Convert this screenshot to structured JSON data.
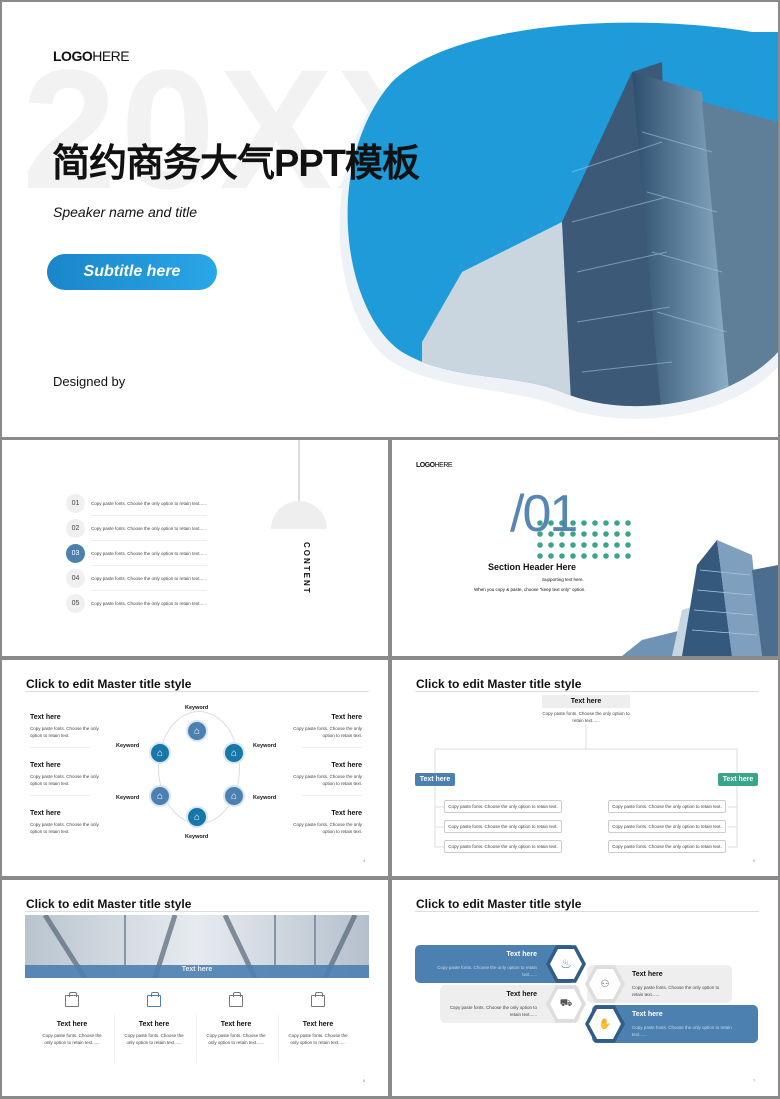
{
  "cover": {
    "bg_text": "20XX",
    "logo_bold": "LOGO",
    "logo_light": "HERE",
    "title": "简约商务大气PPT模板",
    "speaker": "Speaker name and title",
    "subtitle_button": "Subtitle here",
    "designed_by": "Designed by",
    "accent": "#1e9bd8"
  },
  "contents": {
    "vertical_label": "CONTENT",
    "items": [
      {
        "num": "01",
        "text": "Copy paste fonts. Choose the only option to retain text......"
      },
      {
        "num": "02",
        "text": "Copy paste fonts. Choose the only option to retain text......"
      },
      {
        "num": "03",
        "text": "Copy paste fonts. Choose the only option to retain text......",
        "active": true
      },
      {
        "num": "04",
        "text": "Copy paste fonts. Choose the only option to retain text......"
      },
      {
        "num": "05",
        "text": "Copy paste fonts. Choose the only option to retain text......"
      }
    ]
  },
  "section": {
    "logo_bold": "LOGO",
    "logo_light": "HERE",
    "number": "/01",
    "header": "Section Header Here",
    "supporting": "Supporting text here.",
    "note": "When you copy & paste, choose \"keep text only\" option.",
    "dot_color": "#3aa58a"
  },
  "slide4": {
    "title": "Click to edit Master title style",
    "left": [
      {
        "heading": "Text here",
        "body": "Copy paste fonts. Choose the only option to retain text."
      },
      {
        "heading": "Text here",
        "body": "Copy paste fonts. Choose the only option to retain text."
      },
      {
        "heading": "Text here",
        "body": "Copy paste fonts. Choose the only option to retain text."
      }
    ],
    "right": [
      {
        "heading": "Text here",
        "body": "Copy paste fonts. Choose the only option to retain text."
      },
      {
        "heading": "Text here",
        "body": "Copy paste fonts. Choose the only option to retain text."
      },
      {
        "heading": "Text here",
        "body": "Copy paste fonts. Choose the only option to retain text."
      }
    ],
    "keywords": [
      "Keyword",
      "Keyword",
      "Keyword",
      "Keyword",
      "Keyword",
      "Keyword"
    ],
    "page": "4"
  },
  "slide5": {
    "title": "Click to edit Master title style",
    "top_heading": "Text here",
    "top_body": "Copy paste fonts. Choose the only option to retain text......",
    "left_tag": "Text here",
    "right_tag": "Text here",
    "left_items": [
      "Copy paste fonts. Choose the only option to retain text.",
      "Copy paste fonts. Choose the only option to retain text.",
      "Copy paste fonts. Choose the only option to retain text."
    ],
    "right_items": [
      "Copy paste fonts. Choose the only option to retain text.",
      "Copy paste fonts. Choose the only option to retain text.",
      "Copy paste fonts. Choose the only option to retain text."
    ],
    "left_color": "#4c80b1",
    "right_color": "#3aa58a",
    "page": "5"
  },
  "slide6": {
    "title": "Click to edit Master title style",
    "banner_text": "Text here",
    "columns": [
      {
        "heading": "Text here",
        "body": "Copy paste fonts. Choose the only option to retain text......"
      },
      {
        "heading": "Text here",
        "body": "Copy paste fonts. Choose the only option to retain text......"
      },
      {
        "heading": "Text here",
        "body": "Copy paste fonts. Choose the only option to retain text......"
      },
      {
        "heading": "Text here",
        "body": "Copy paste fonts. Choose the only option to retain text......"
      }
    ],
    "page": "6"
  },
  "slide7": {
    "title": "Click to edit Master title style",
    "items": [
      {
        "heading": "Text here",
        "body": "Copy paste fonts. Choose the only option to retain text......",
        "icon": "fire-icon"
      },
      {
        "heading": "Text here",
        "body": "Copy paste fonts. Choose the only option to retain text......",
        "icon": "people-coin-icon"
      },
      {
        "heading": "Text here",
        "body": "Copy paste fonts. Choose the only option to retain text......",
        "icon": "car-icon"
      },
      {
        "heading": "Text here",
        "body": "Copy paste fonts. Choose the only option to retain text......",
        "icon": "hand-coin-icon"
      }
    ],
    "page": "7"
  }
}
